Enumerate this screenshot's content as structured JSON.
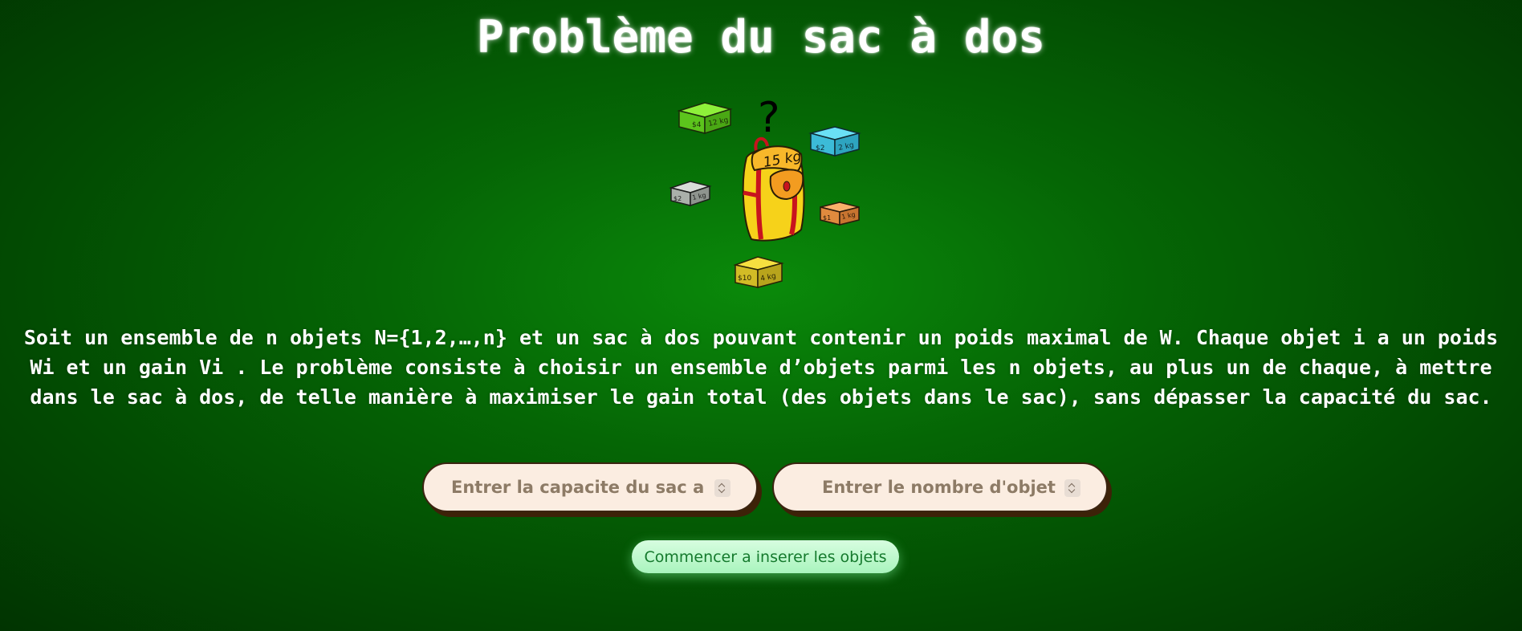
{
  "page": {
    "title": "Problème du sac à dos"
  },
  "illustration": {
    "question_mark": "?",
    "backpack_label": "15 kg",
    "boxes": [
      {
        "price": "$4",
        "weight": "12 kg",
        "color": "#6fd81e"
      },
      {
        "price": "$2",
        "weight": "2 kg",
        "color": "#3fc8e8"
      },
      {
        "price": "$2",
        "weight": "1 kg",
        "color": "#b8bcb8"
      },
      {
        "price": "$1",
        "weight": "1 kg",
        "color": "#f29a4e"
      },
      {
        "price": "$10",
        "weight": "4 kg",
        "color": "#e8d23a"
      }
    ]
  },
  "description": {
    "line1": "Soit un ensemble de n objets N={1,2,…,n} et un sac à dos pouvant contenir un poids maximal de W. Chaque objet i a un poids",
    "line2": "Wi et un gain Vi . Le problème consiste à choisir un ensemble d’objets parmi les n objets, au plus un de chaque, à mettre",
    "line3": "dans le sac à dos, de telle manière à maximiser le gain total (des objets dans le sac), sans dépasser la capacité du sac."
  },
  "form": {
    "capacity_placeholder": "Entrer la capacite du sac a dos",
    "capacity_value": "",
    "count_placeholder": "Entrer le nombre d'objets",
    "count_value": "",
    "start_button_label": "Commencer a inserer les objets"
  },
  "colors": {
    "background": "#056605",
    "input_background": "#fbede1",
    "input_shadow": "#3d2208",
    "button_background": "#b9f7c9",
    "button_text": "#157a2d"
  }
}
